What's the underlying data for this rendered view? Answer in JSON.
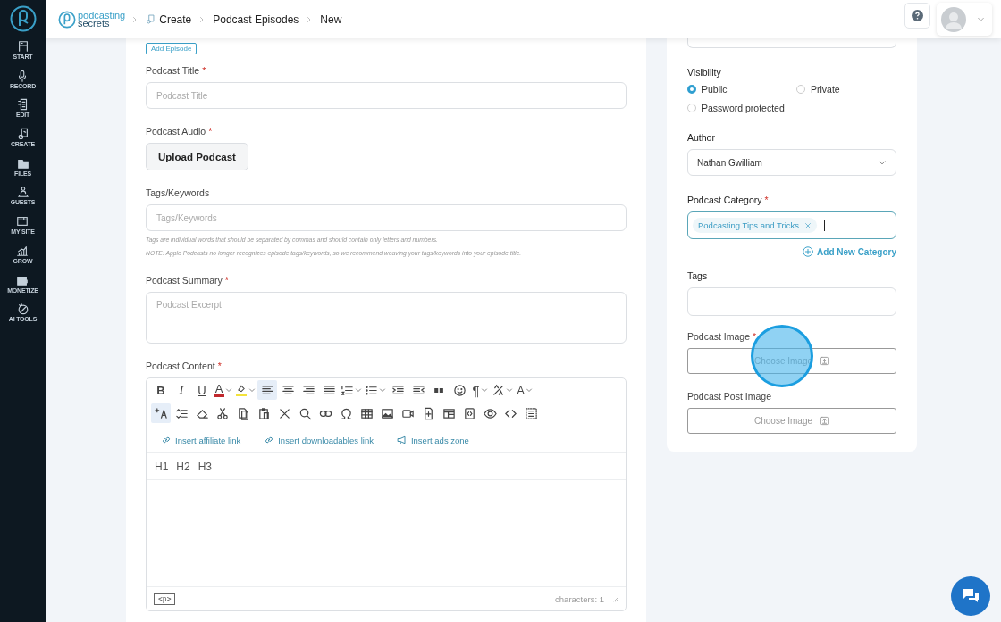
{
  "sidebar": {
    "items": [
      {
        "label": "START"
      },
      {
        "label": "RECORD"
      },
      {
        "label": "EDIT"
      },
      {
        "label": "CREATE"
      },
      {
        "label": "FILES"
      },
      {
        "label": "GUESTS"
      },
      {
        "label": "MY SITE"
      },
      {
        "label": "GROW"
      },
      {
        "label": "MONETIZE"
      },
      {
        "label": "AI TOOLS"
      }
    ]
  },
  "header": {
    "logo": {
      "line_1": "podcasting",
      "line_2": "secrets"
    },
    "breadcrumb": [
      {
        "label": "Create"
      },
      {
        "label": "Podcast Episodes"
      },
      {
        "label": "New"
      }
    ]
  },
  "form": {
    "add_episode_button": "Add Episode",
    "fields": [
      {
        "kind": "text",
        "label": "Podcast Title",
        "mark": "*",
        "placeholder": "Podcast Title"
      },
      {
        "kind": "upload",
        "label": "Podcast Audio",
        "mark": "*",
        "button": "Upload Podcast"
      },
      {
        "kind": "text",
        "label": "Tags/Keywords",
        "placeholder": "Tags/Keywords",
        "help": [
          "Tags are individual words that should be separated by commas and should contain only letters and numbers.",
          "NOTE: Apple Podcasts no longer recognizes episode tags/keywords, so we recommend weaving your tags/keywords into your episode title."
        ]
      },
      {
        "kind": "textarea",
        "label": "Podcast Summary",
        "mark": "*",
        "placeholder": "Podcast Excerpt"
      },
      {
        "kind": "editor",
        "label": "Podcast Content",
        "mark": "*"
      }
    ]
  },
  "editor": {
    "toolbar": [
      [
        {
          "label": "B",
          "selected": false
        },
        {
          "label": "I",
          "selected": false
        },
        {
          "label": "U",
          "selected": false
        },
        {
          "label": "A",
          "dropdown": true,
          "selected": false
        },
        {
          "dropdown": true,
          "selected": false
        },
        {
          "selected": true
        },
        {
          "selected": false
        },
        {
          "selected": false
        },
        {
          "selected": false
        },
        {
          "dropdown": true,
          "selected": false
        },
        {
          "dropdown": true,
          "selected": false
        },
        {
          "selected": false
        },
        {
          "selected": false
        },
        {
          "selected": false
        },
        {
          "selected": false
        },
        {
          "label": "¶",
          "dropdown": true,
          "selected": false
        },
        {
          "dropdown": true,
          "selected": false
        },
        {
          "label": "A",
          "dropdown": true,
          "selected": false
        }
      ],
      [
        {
          "selected": true
        },
        {
          "selected": false
        },
        {
          "selected": false
        },
        {
          "selected": false
        },
        {
          "selected": false
        },
        {
          "selected": false
        },
        {
          "selected": false
        },
        {
          "selected": false
        },
        {
          "selected": false
        },
        {
          "selected": false
        },
        {
          "selected": false
        },
        {
          "selected": false
        },
        {
          "selected": false
        },
        {
          "selected": false
        },
        {
          "selected": false
        },
        {
          "selected": false
        },
        {
          "selected": false
        },
        {
          "selected": false
        },
        {
          "selected": false
        }
      ]
    ],
    "links": [
      {
        "label": "Insert affiliate link"
      },
      {
        "label": "Insert downloadables link"
      },
      {
        "label": "Insert ads zone"
      }
    ],
    "headings": [
      "H1",
      "H2",
      "H3"
    ],
    "path_tag": "<p>",
    "counter": "characters: 1"
  },
  "side": {
    "visibility": {
      "label": "Visibility",
      "options": [
        {
          "label": "Public",
          "selected": true
        },
        {
          "label": "Private",
          "selected": false
        },
        {
          "label": "Password protected",
          "selected": false
        }
      ]
    },
    "author": {
      "label": "Author",
      "value": "Nathan Gwilliam"
    },
    "category": {
      "label": "Podcast Category",
      "mark": "*",
      "chips": [
        {
          "label": "Podcasting Tips and Tricks"
        }
      ],
      "add_link": "Add New Category"
    },
    "tags": {
      "label": "Tags"
    },
    "images": [
      {
        "label": "Podcast Image",
        "mark": "*",
        "button": "Choose Image",
        "highlighted": true
      },
      {
        "label": "Podcast Post Image",
        "button": "Choose Image",
        "highlighted": false
      }
    ]
  }
}
